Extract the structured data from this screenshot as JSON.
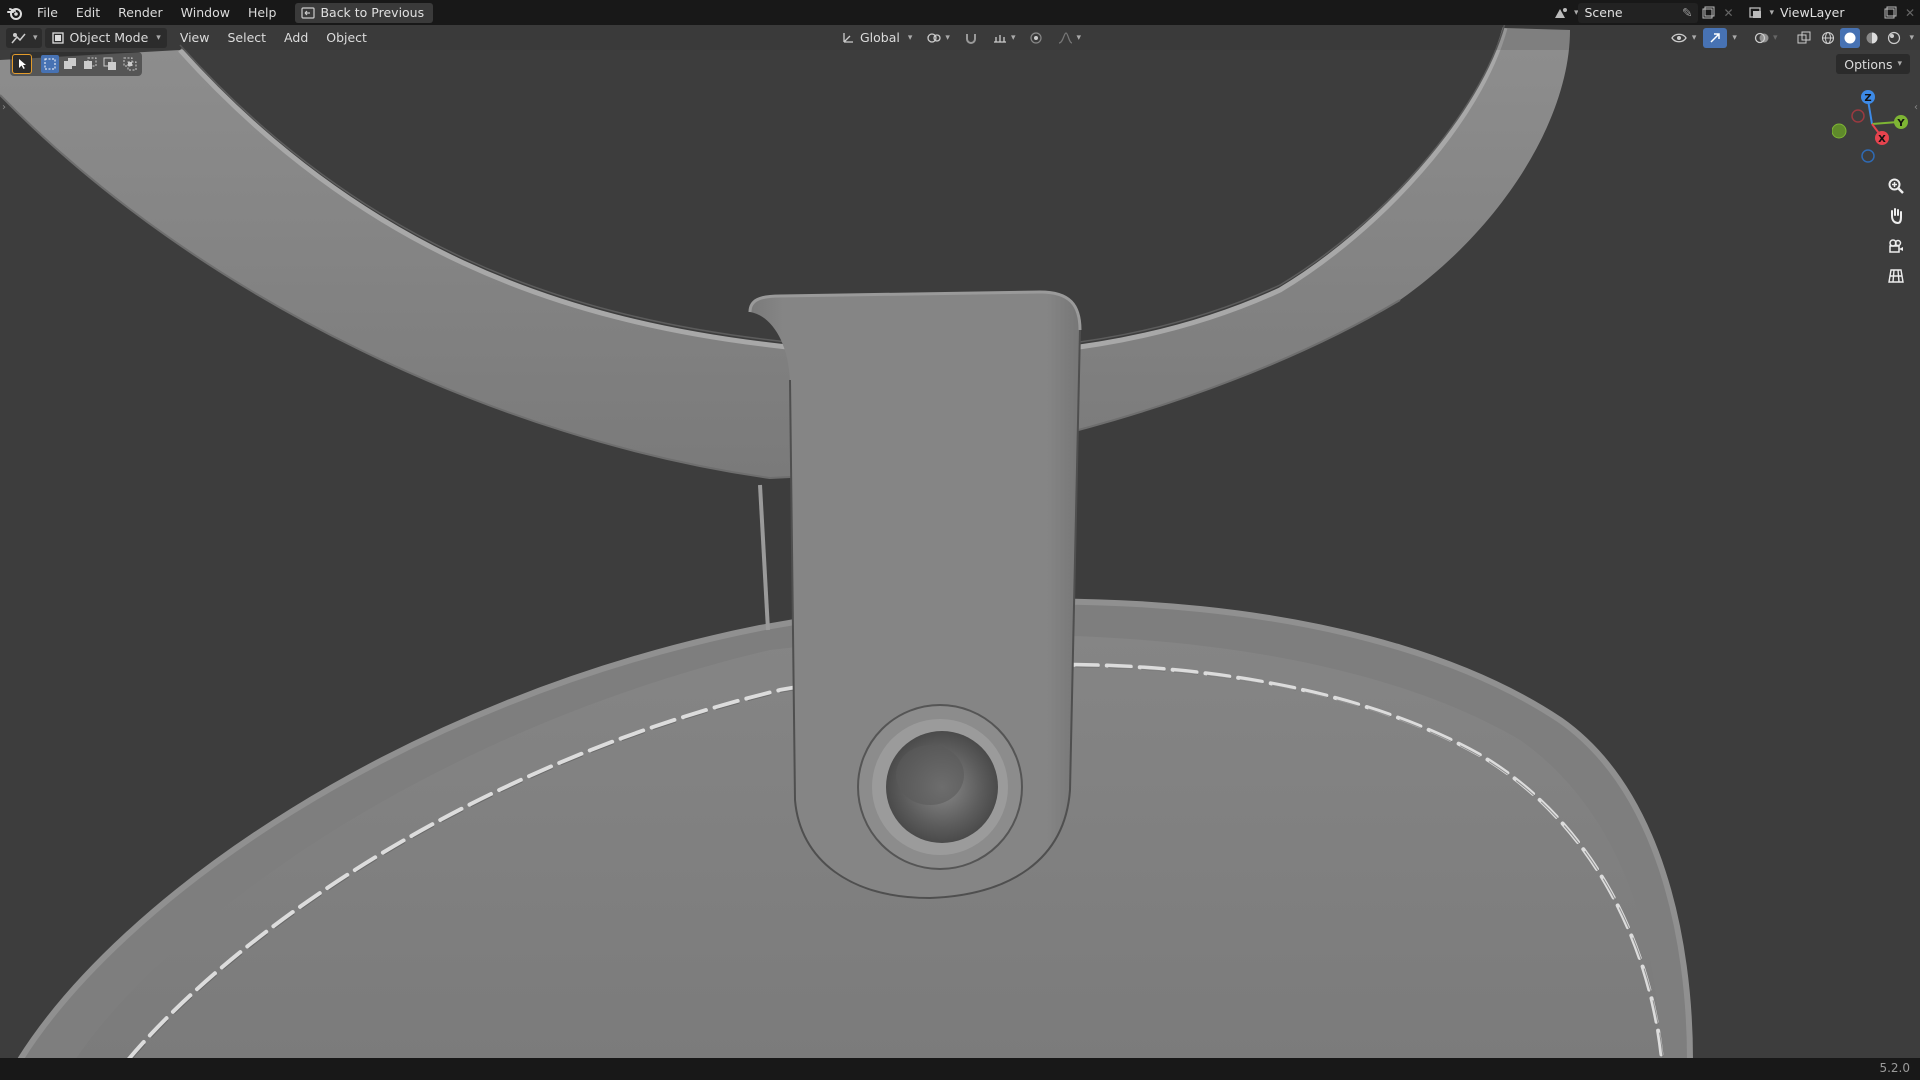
{
  "menu": {
    "items": [
      "File",
      "Edit",
      "Render",
      "Window",
      "Help"
    ],
    "back_label": "Back to Previous"
  },
  "top_right": {
    "scene_label": "Scene",
    "view_layer_label": "ViewLayer"
  },
  "viewport_header": {
    "mode_label": "Object Mode",
    "menus": [
      "View",
      "Select",
      "Add",
      "Object"
    ],
    "transform_orientation": "Global"
  },
  "options_label": "Options",
  "gizmo": {
    "x": "X",
    "y": "Y",
    "z": "Z"
  },
  "status": {
    "version": "5.2.0"
  },
  "colors": {
    "accent_orange": "#e39b2b",
    "selected_blue": "#4772b3",
    "x_axis": "#e6434e",
    "y_axis": "#7eb534",
    "z_axis": "#3d8ae6"
  },
  "icons": [
    "blender-logo-icon",
    "editor-type-icon",
    "select-tool-icon",
    "zoom-icon",
    "hand-pan-icon",
    "camera-icon",
    "grid-ortho-icon"
  ]
}
